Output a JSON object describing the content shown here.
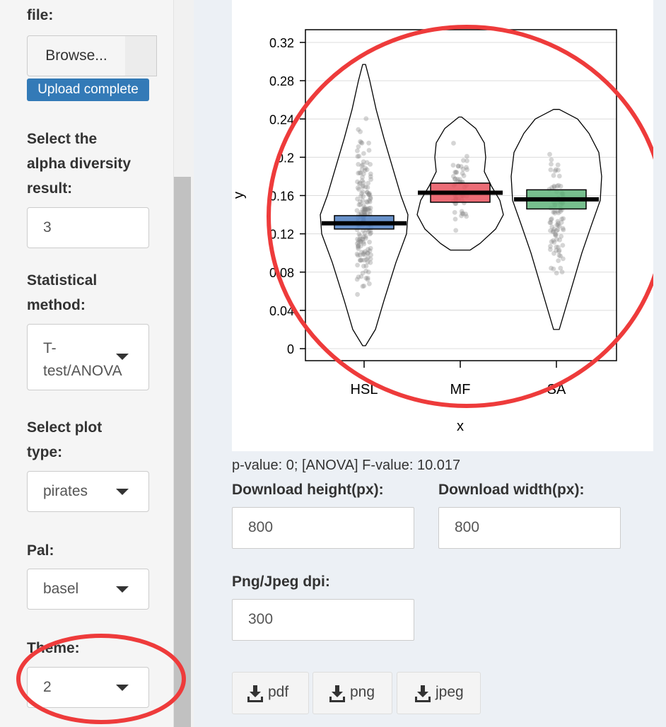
{
  "sidebar": {
    "file_label": "file:",
    "browse_label": "Browse...",
    "upload_status": "Upload complete",
    "alpha_label": [
      "Select the",
      "alpha diversity",
      "result:"
    ],
    "alpha_value": "3",
    "method_label": [
      "Statistical",
      "method:"
    ],
    "method_value": [
      "T-",
      "test/ANOVA"
    ],
    "plot_type_label": [
      "Select plot",
      "type:"
    ],
    "plot_type_value": "pirates",
    "pal_label": "Pal:",
    "pal_value": "basel",
    "theme_label": "Theme:",
    "theme_value": "2"
  },
  "chart_data": {
    "type": "pirateplot",
    "xlabel": "x",
    "ylabel": "y",
    "ylim": [
      0,
      0.33
    ],
    "yticks": [
      "0",
      "0.04",
      "0.08",
      "0.12",
      "0.16",
      "0.2",
      "0.24",
      "0.28",
      "0.32"
    ],
    "grid": true,
    "categories": [
      "HSL",
      "MF",
      "SA"
    ],
    "means": [
      0.131,
      0.163,
      0.156
    ],
    "ci_low": [
      0.125,
      0.153,
      0.146
    ],
    "ci_high": [
      0.139,
      0.173,
      0.166
    ],
    "min": [
      0.003,
      0.103,
      0.02
    ],
    "max": [
      0.297,
      0.242,
      0.25
    ],
    "colors": [
      "#4f7fc1",
      "#e7525e",
      "#5fb47a"
    ]
  },
  "main": {
    "result_text": "p-value: 0; [ANOVA] F-value: 10.017",
    "height_label": "Download height(px):",
    "height_value": "800",
    "width_label": "Download width(px):",
    "width_value": "800",
    "dpi_label": "Png/Jpeg dpi:",
    "dpi_value": "300",
    "btn_pdf": "pdf",
    "btn_png": "png",
    "btn_jpeg": "jpeg"
  },
  "annotation_color": "#ee3b3b"
}
